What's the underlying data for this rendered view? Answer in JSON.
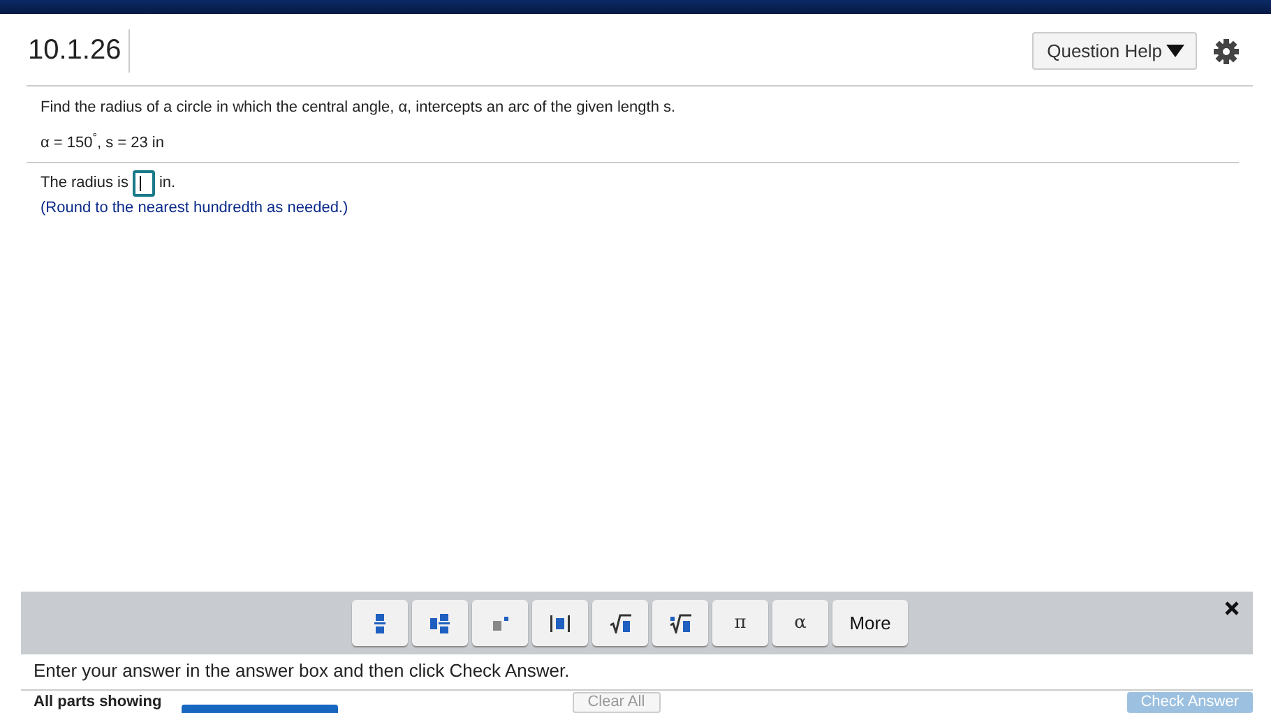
{
  "header": {
    "question_number": "10.1.26",
    "help_button": "Question Help"
  },
  "question": {
    "prompt": "Find the radius of a circle in which the central angle, α,  intercepts an arc of the given length s.",
    "given": "α = 150$^{°}$, s = 23 in"
  },
  "answer": {
    "before": "The radius is",
    "after": "in.",
    "hint": "(Round to the nearest hundredth as needed.)"
  },
  "math_toolbar": {
    "buttons": [
      {
        "kind": "fraction"
      },
      {
        "kind": "mixed"
      },
      {
        "kind": "exponent"
      },
      {
        "kind": "absolute"
      },
      {
        "kind": "sqrt"
      },
      {
        "kind": "nthroot"
      },
      {
        "kind": "text",
        "label": "π"
      },
      {
        "kind": "text",
        "label": "α"
      },
      {
        "kind": "wide",
        "label": "More"
      }
    ]
  },
  "instruction": "Enter your answer in the answer box and then click Check Answer.",
  "footer": {
    "parts_label": "All parts showing",
    "clear_button": "Clear All",
    "check_button": "Check Answer"
  }
}
